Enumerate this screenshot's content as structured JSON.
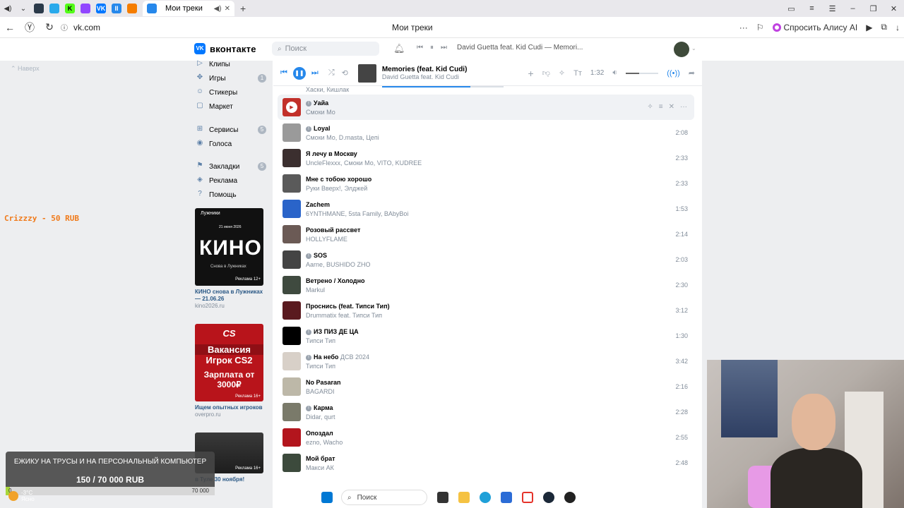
{
  "browser": {
    "tab_title": "Мои треки",
    "tab_plus": "+",
    "url": "vk.com",
    "page_title": "Мои треки",
    "alice_button": "Спросить Алису AI"
  },
  "header": {
    "logo_text": "вконтакте",
    "logo_mark": "VK",
    "search_placeholder": "Поиск",
    "mini_player_track": "David Guetta feat. Kid Cudi — Memori..."
  },
  "scroll_top": "Наверх",
  "sidebar": {
    "items": [
      {
        "label": "Клипы",
        "icon": "clips-icon"
      },
      {
        "label": "Игры",
        "icon": "games-icon",
        "count": "1"
      },
      {
        "label": "Стикеры",
        "icon": "stickers-icon"
      },
      {
        "label": "Маркет",
        "icon": "market-icon"
      },
      {
        "label": "Сервисы",
        "icon": "services-icon",
        "count": "5"
      },
      {
        "label": "Голоса",
        "icon": "votes-icon"
      },
      {
        "label": "Закладки",
        "icon": "bookmarks-icon",
        "count": "5"
      },
      {
        "label": "Реклама",
        "icon": "ads-icon"
      },
      {
        "label": "Помощь",
        "icon": "help-icon"
      }
    ],
    "ads": [
      {
        "title": "КИНО снова в Лужниках — 21.06.26",
        "domain": "kino2026.ru",
        "img_top": "Лужники",
        "img_date": "21 июня 2026",
        "img_big": "КИНО",
        "img_sub": "Снова в Лужниках",
        "age": "Реклама 12+"
      },
      {
        "title": "Ищем опытных игроков",
        "domain": "overpro.ru",
        "img_logo": "CS",
        "img_line1": "Вакансия",
        "img_line2": "Игрок CS2",
        "img_line3": "Зарплата от 3000₽",
        "age": "Реклама 16+"
      },
      {
        "title": "в Туле 30 ноября!",
        "age": "Реклама 16+"
      }
    ]
  },
  "player": {
    "title": "Memories (feat. Kid Cudi)",
    "artist": "David Guetta feat. Kid Cudi",
    "time": "1:32",
    "progress": 0.73,
    "volume": 0.4
  },
  "tracks_partial_top": "Хаски, Кишлак",
  "tracks": [
    {
      "title": "Уайа",
      "artist": "Смоки Мо",
      "duration": "",
      "explicit": true,
      "hover": true,
      "cover": "#c2302a"
    },
    {
      "title": "Loyal",
      "artist": "Смоки Мо, D.masta, Цепі",
      "duration": "2:08",
      "explicit": true,
      "cover": "#9a9a9a"
    },
    {
      "title": "Я лечу в Москву",
      "artist": "UncleFlexxx, Смоки Мо, VITO, KUDREE",
      "duration": "2:33",
      "cover": "#3b2f2f"
    },
    {
      "title": "Мне с тобою хорошо",
      "artist": "Руки Вверх!, Элджей",
      "duration": "2:33",
      "cover": "#5a5a5a"
    },
    {
      "title": "Zachem",
      "artist": "6YNTHMANE, 5sta Family, BAbyBoi",
      "duration": "1:53",
      "cover": "#2a64c9"
    },
    {
      "title": "Розовый рассвет",
      "artist": "HOLLYFLAME",
      "duration": "2:14",
      "cover": "#6b5a55"
    },
    {
      "title": "SOS",
      "artist": "Aarne, BUSHIDO ZHO",
      "duration": "2:03",
      "explicit": true,
      "cover": "#444444"
    },
    {
      "title": "Ветрено / Холодно",
      "artist": "Markul",
      "duration": "2:30",
      "cover": "#3f4a3f"
    },
    {
      "title": "Проснись (feat. Типси Тип)",
      "artist": "Drummatix feat. Типси Тип",
      "duration": "3:12",
      "cover": "#5a1a1f"
    },
    {
      "title": "ИЗ ПИЗ ДЕ ЦА",
      "artist": "Типси Тип",
      "duration": "1:30",
      "explicit": true,
      "cover": "#000000"
    },
    {
      "title": "На небо",
      "subtitle": "ДСВ 2024",
      "artist": "Типси Тип",
      "duration": "3:42",
      "explicit": true,
      "cover": "#d8d0c8"
    },
    {
      "title": "No Pasaran",
      "artist": "BAGARDI",
      "duration": "2:16",
      "cover": "#bdb8a8"
    },
    {
      "title": "Карма",
      "artist": "Didar, qurt",
      "duration": "2:28",
      "explicit": true,
      "cover": "#7a7a6a"
    },
    {
      "title": "Опоздал",
      "artist": "ezno, Wacho",
      "duration": "2:55",
      "cover": "#b3151d"
    },
    {
      "title": "Мой брат",
      "artist": "Макси АК",
      "duration": "2:48",
      "cover": "#3c4a3c"
    }
  ],
  "overlay": {
    "crizzzy": "Crizzzy - 50 RUB",
    "goal_text": "ЕЖИКУ НА ТРУСЫ И НА ПЕРСОНАЛЬНЫЙ КОМПЬЮТЕР",
    "goal_amount": "150 / 70 000 RUB",
    "goal_start": "0",
    "goal_end": "70 000",
    "goal_progress": 0.002
  },
  "weather": {
    "temp": "-3°C",
    "desc": "Ясно"
  },
  "taskbar": {
    "search_label": "Поиск"
  }
}
